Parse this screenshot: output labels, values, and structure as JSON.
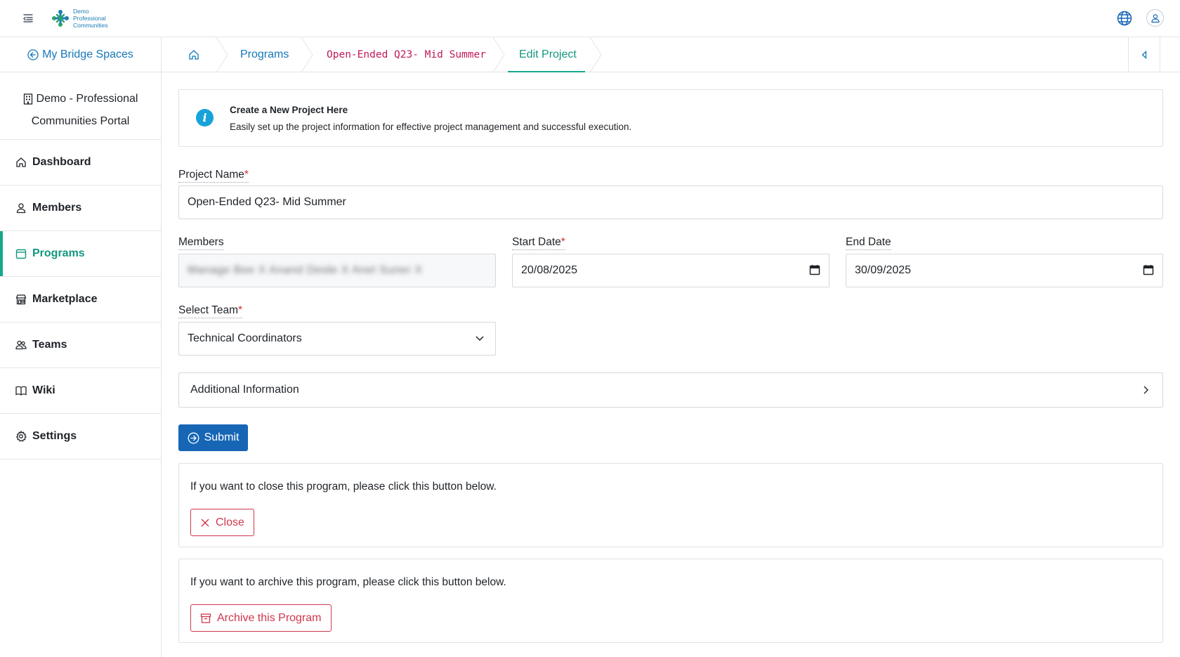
{
  "brand": {
    "logo_lines": [
      "Demo",
      "Professional",
      "Communities"
    ],
    "primary_color": "#1666b5",
    "accent_color": "#14a88d",
    "danger_color": "#d0364d"
  },
  "topbar": {
    "menu_icon": "menu-collapse-icon",
    "language_icon": "globe-icon",
    "user_icon": "user-icon"
  },
  "sidebar": {
    "bridge_link": "My Bridge Spaces",
    "portal_line1": "Demo - Professional",
    "portal_line2": "Communities Portal",
    "items": [
      {
        "label": "Dashboard",
        "icon": "home-icon"
      },
      {
        "label": "Members",
        "icon": "user-icon"
      },
      {
        "label": "Programs",
        "icon": "calendar-icon",
        "active": true
      },
      {
        "label": "Marketplace",
        "icon": "store-icon"
      },
      {
        "label": "Teams",
        "icon": "users-icon"
      },
      {
        "label": "Wiki",
        "icon": "book-icon"
      },
      {
        "label": "Settings",
        "icon": "gear-icon"
      }
    ]
  },
  "breadcrumb": {
    "home_icon": "home-icon",
    "items": [
      "Programs",
      "Open-Ended Q23- Mid Summer",
      "Edit Project"
    ]
  },
  "info": {
    "title": "Create a New Project Here",
    "subtitle": "Easily set up the project information for effective project management and successful execution."
  },
  "form": {
    "project_name": {
      "label": "Project Name",
      "value": "Open-Ended Q23- Mid Summer"
    },
    "members": {
      "label": "Members",
      "value": "Manage Bee X   Anand Deide X   Anel Suner X"
    },
    "start_date": {
      "label": "Start Date",
      "value": "20/08/2025"
    },
    "end_date": {
      "label": "End Date",
      "value": "30/09/2025"
    },
    "team": {
      "label": "Select Team",
      "value": "Technical Coordinators"
    },
    "additional_info": "Additional Information",
    "submit_label": "Submit"
  },
  "close_panel": {
    "text": "If you want to close this program, please click this button below.",
    "button": "Close"
  },
  "archive_panel": {
    "text": "If you want to archive this program, please click this button below.",
    "button": "Archive this Program"
  }
}
